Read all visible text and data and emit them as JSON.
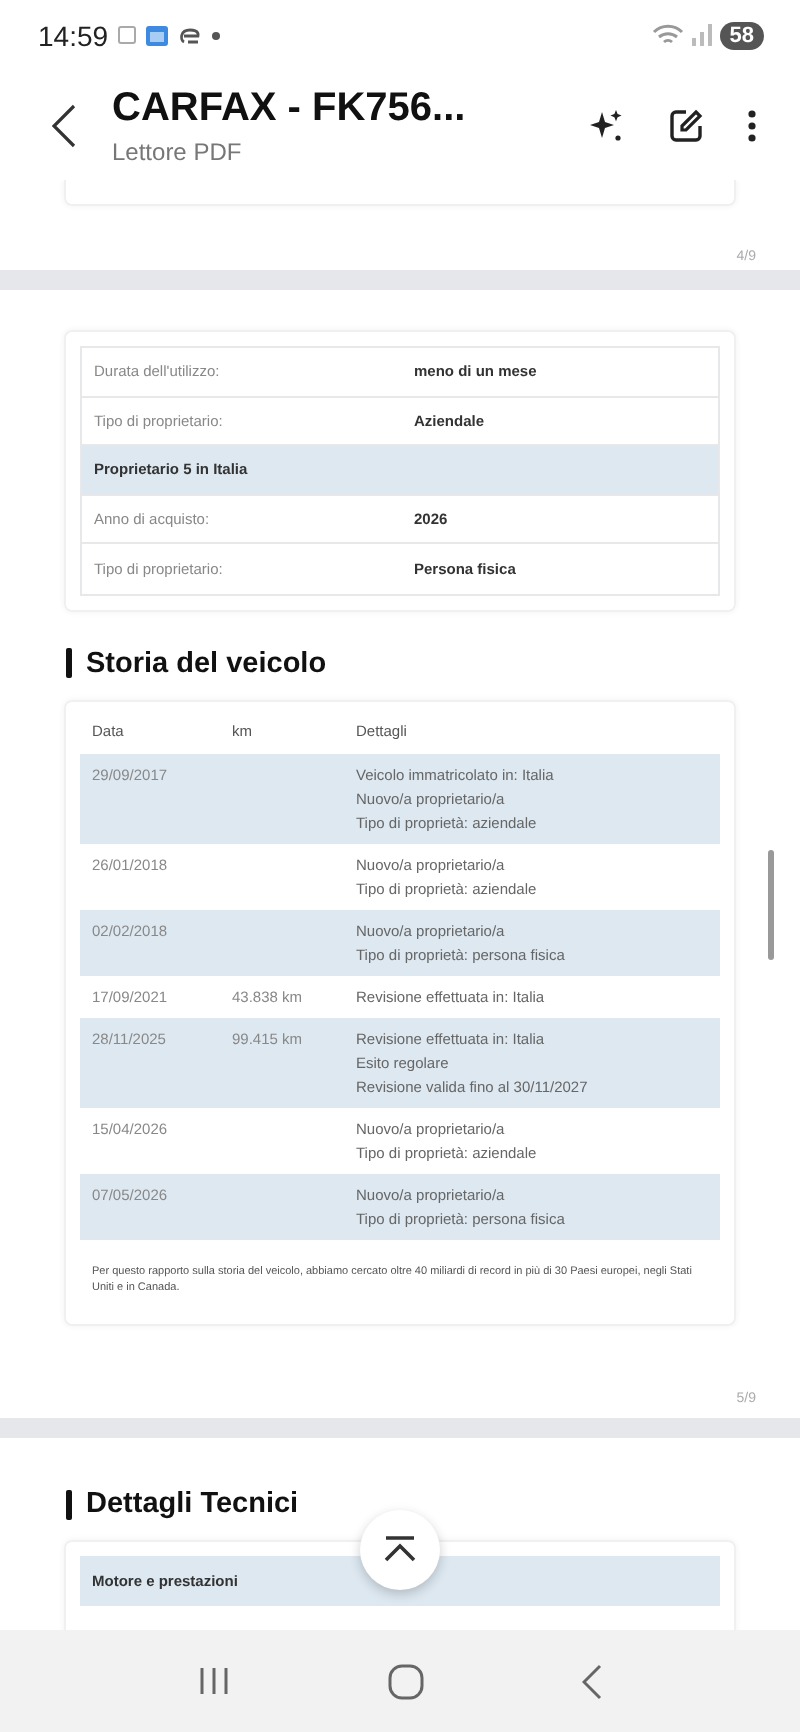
{
  "status_bar": {
    "time": "14:59",
    "battery": "58"
  },
  "header": {
    "title": "CARFAX - FK756...",
    "subtitle": "Lettore PDF"
  },
  "page_4": {
    "page_number": "4/9"
  },
  "page_5": {
    "owner_table": {
      "rows": [
        {
          "kind": "field",
          "label": "Durata dell'utilizzo:",
          "value": "meno di un mese"
        },
        {
          "kind": "field",
          "label": "Tipo di proprietario:",
          "value": "Aziendale"
        },
        {
          "kind": "section",
          "label": "Proprietario 5 in Italia"
        },
        {
          "kind": "field",
          "label": "Anno di acquisto:",
          "value": "2026"
        },
        {
          "kind": "field",
          "label": "Tipo di proprietario:",
          "value": "Persona fisica"
        }
      ]
    },
    "history": {
      "title": "Storia del veicolo",
      "columns": [
        "Data",
        "km",
        "Dettagli"
      ],
      "rows": [
        {
          "date": "29/09/2017",
          "details": [
            "Veicolo immatricolato in: Italia",
            "Nuovo/a proprietario/a",
            "Tipo di proprietà: aziendale"
          ]
        },
        {
          "date": "26/01/2018",
          "details": [
            "Nuovo/a proprietario/a",
            "Tipo di proprietà: aziendale"
          ]
        },
        {
          "date": "02/02/2018",
          "details": [
            "Nuovo/a proprietario/a",
            "Tipo di proprietà: persona fisica"
          ]
        },
        {
          "date": "17/09/2021",
          "km": "43.838 km",
          "details": [
            "Revisione effettuata in: Italia"
          ]
        },
        {
          "date": "28/11/2025",
          "km": "99.415 km",
          "details": [
            "Revisione effettuata in: Italia",
            "Esito regolare",
            "Revisione valida fino al 30/11/2027"
          ]
        },
        {
          "date": "15/04/2026",
          "details": [
            "Nuovo/a proprietario/a",
            "Tipo di proprietà: aziendale"
          ]
        },
        {
          "date": "07/05/2026",
          "details": [
            "Nuovo/a proprietario/a",
            "Tipo di proprietà: persona fisica"
          ]
        }
      ],
      "note": "Per questo rapporto sulla storia del veicolo, abbiamo cercato oltre 40 miliardi di record in più di 30 Paesi europei, negli Stati Uniti e in Canada."
    },
    "page_number": "5/9"
  },
  "page_6": {
    "title": "Dettagli Tecnici",
    "rows": [
      {
        "kind": "section",
        "label": "Motore e prestazioni"
      }
    ]
  }
}
